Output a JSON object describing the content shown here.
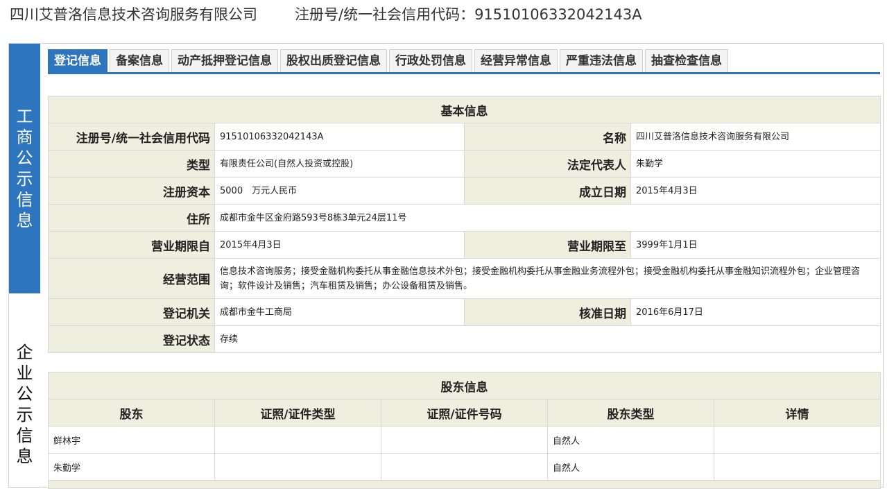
{
  "header": {
    "company": "四川艾普洛信息技术咨询服务有限公司",
    "reg_label_and_number": "注册号/统一社会信用代码：91510106332042143A"
  },
  "side_tabs": {
    "active_chars": [
      "工",
      "商",
      "公",
      "示",
      "信",
      "息"
    ],
    "inactive_chars": [
      "企",
      "业",
      "公",
      "示",
      "信",
      "息"
    ]
  },
  "tabs": [
    {
      "label": "登记信息",
      "active": true
    },
    {
      "label": "备案信息",
      "active": false
    },
    {
      "label": "动产抵押登记信息",
      "active": false
    },
    {
      "label": "股权出质登记信息",
      "active": false
    },
    {
      "label": "行政处罚信息",
      "active": false
    },
    {
      "label": "经营异常信息",
      "active": false
    },
    {
      "label": "严重违法信息",
      "active": false
    },
    {
      "label": "抽查检查信息",
      "active": false
    }
  ],
  "basic_info": {
    "title": "基本信息",
    "reg_no_label": "注册号/统一社会信用代码",
    "reg_no": "91510106332042143A",
    "name_label": "名称",
    "name": "四川艾普洛信息技术咨询服务有限公司",
    "type_label": "类型",
    "type": "有限责任公司(自然人投资或控股)",
    "legal_rep_label": "法定代表人",
    "legal_rep": "朱勤学",
    "capital_label": "注册资本",
    "capital": "5000　万元人民币",
    "established_label": "成立日期",
    "established": "2015年4月3日",
    "address_label": "住所",
    "address": "成都市金牛区金府路593号8栋3单元24层11号",
    "term_from_label": "营业期限自",
    "term_from": "2015年4月3日",
    "term_to_label": "营业期限至",
    "term_to": "3999年1月1日",
    "scope_label": "经营范围",
    "scope": "信息技术咨询服务；接受金融机构委托从事金融信息技术外包；接受金融机构委托从事金融业务流程外包；接受金融机构委托从事金融知识流程外包；企业管理咨询；软件设计及销售；汽车租赁及销售；办公设备租赁及销售。",
    "authority_label": "登记机关",
    "authority": "成都市金牛工商局",
    "approved_label": "核准日期",
    "approved": "2016年6月17日",
    "status_label": "登记状态",
    "status": "存续"
  },
  "shareholders": {
    "title": "股东信息",
    "columns": [
      "股东",
      "证照/证件类型",
      "证照/证件号码",
      "股东类型",
      "详情"
    ],
    "rows": [
      {
        "name": "鲜林宇",
        "id_type": "",
        "id_no": "",
        "holder_type": "自然人",
        "detail": ""
      },
      {
        "name": "朱勤学",
        "id_type": "",
        "id_no": "",
        "holder_type": "自然人",
        "detail": ""
      }
    ]
  }
}
